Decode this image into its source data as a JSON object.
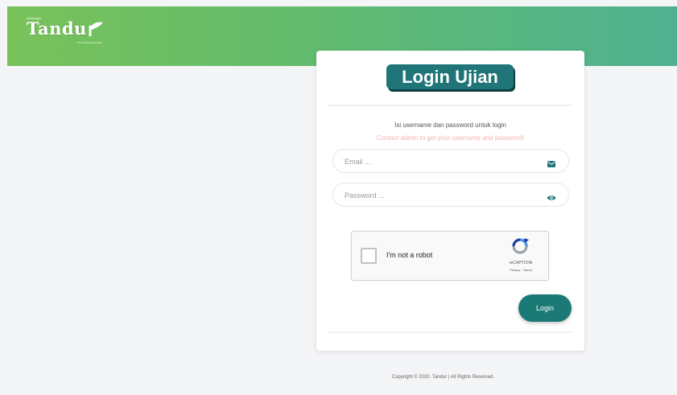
{
  "brand": {
    "small_caption": "Kenangan",
    "name": "Tandu",
    "tagline": "PT Alif Aldila Nusantara"
  },
  "login": {
    "title": "Login Ujian",
    "subtitle": "Isi username dan password untuk login",
    "hint": "Contact admin to get your username and password!",
    "email_placeholder": "Email ...",
    "email_value": "",
    "password_placeholder": "Password ...",
    "password_value": "",
    "email_icon": "envelope-icon",
    "password_icon": "eye-icon",
    "button_label": "Login"
  },
  "recaptcha": {
    "label": "I'm not a robot",
    "brand": "reCAPTCHA",
    "links": "Privacy - Terms"
  },
  "footer": {
    "text": "Copyright © 2020. Tandur | All Rights Reserved."
  },
  "colors": {
    "header_start": "#79c25a",
    "header_end": "#4fb191",
    "primary": "#1f7577",
    "hint": "#f6b2b5"
  }
}
